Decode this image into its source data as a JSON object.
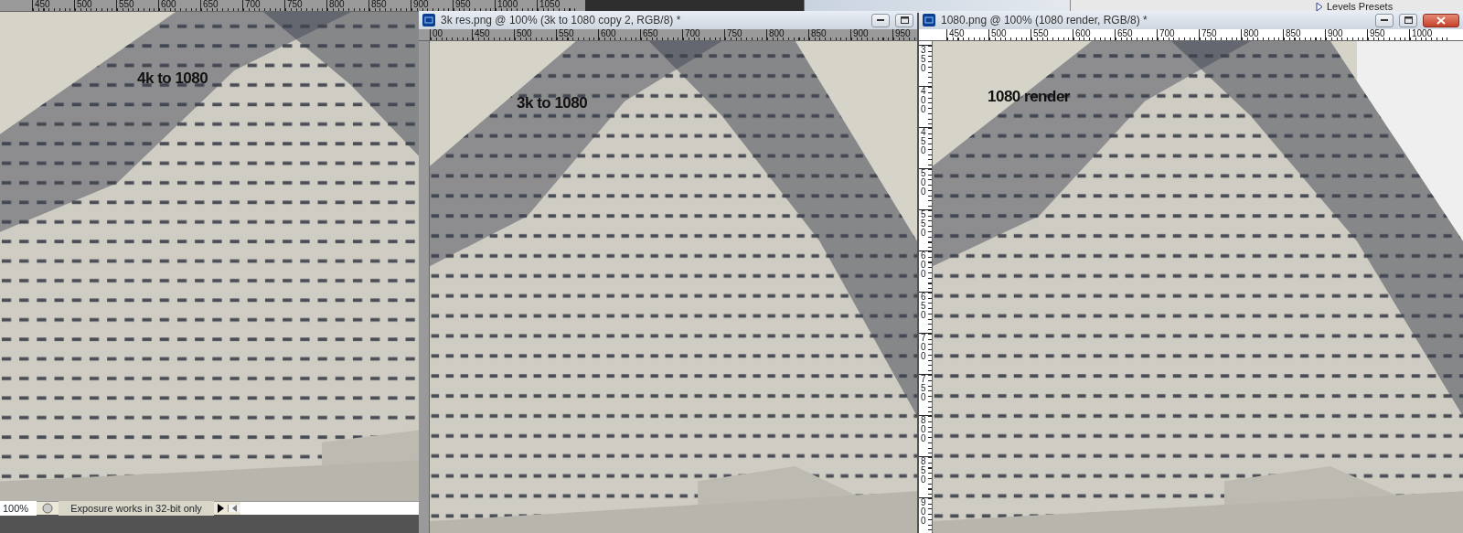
{
  "top_panel": {
    "title": "Levels Presets",
    "expanded": false
  },
  "windows": [
    {
      "kind": "background",
      "ruler_labels": [
        "450",
        "500",
        "550",
        "600",
        "650",
        "700",
        "750",
        "800",
        "850",
        "900",
        "950",
        "1000",
        "1050"
      ],
      "image_label": "4k to 1080",
      "status_bar": {
        "zoom": "100%",
        "message": "Exposure works in 32-bit only"
      }
    },
    {
      "kind": "floating",
      "title": "3k res.png @ 100% (3k to 1080 copy 2, RGB/8) *",
      "ruler_labels": [
        "00",
        "450",
        "500",
        "550",
        "600",
        "650",
        "700",
        "750",
        "800",
        "850",
        "900",
        "950"
      ],
      "image_label": "3k to 1080",
      "close_button": false
    },
    {
      "kind": "floating",
      "title": "1080.png @ 100% (1080 render, RGB/8) *",
      "ruler_labels": [
        "450",
        "500",
        "550",
        "600",
        "650",
        "700",
        "750",
        "800",
        "850",
        "900",
        "950",
        "1000"
      ],
      "vertical_ruler_labels": [
        "350",
        "400",
        "450",
        "500",
        "550",
        "600",
        "650",
        "700",
        "750",
        "800",
        "850",
        "900"
      ],
      "image_label": "1080 render",
      "close_button": true
    }
  ]
}
